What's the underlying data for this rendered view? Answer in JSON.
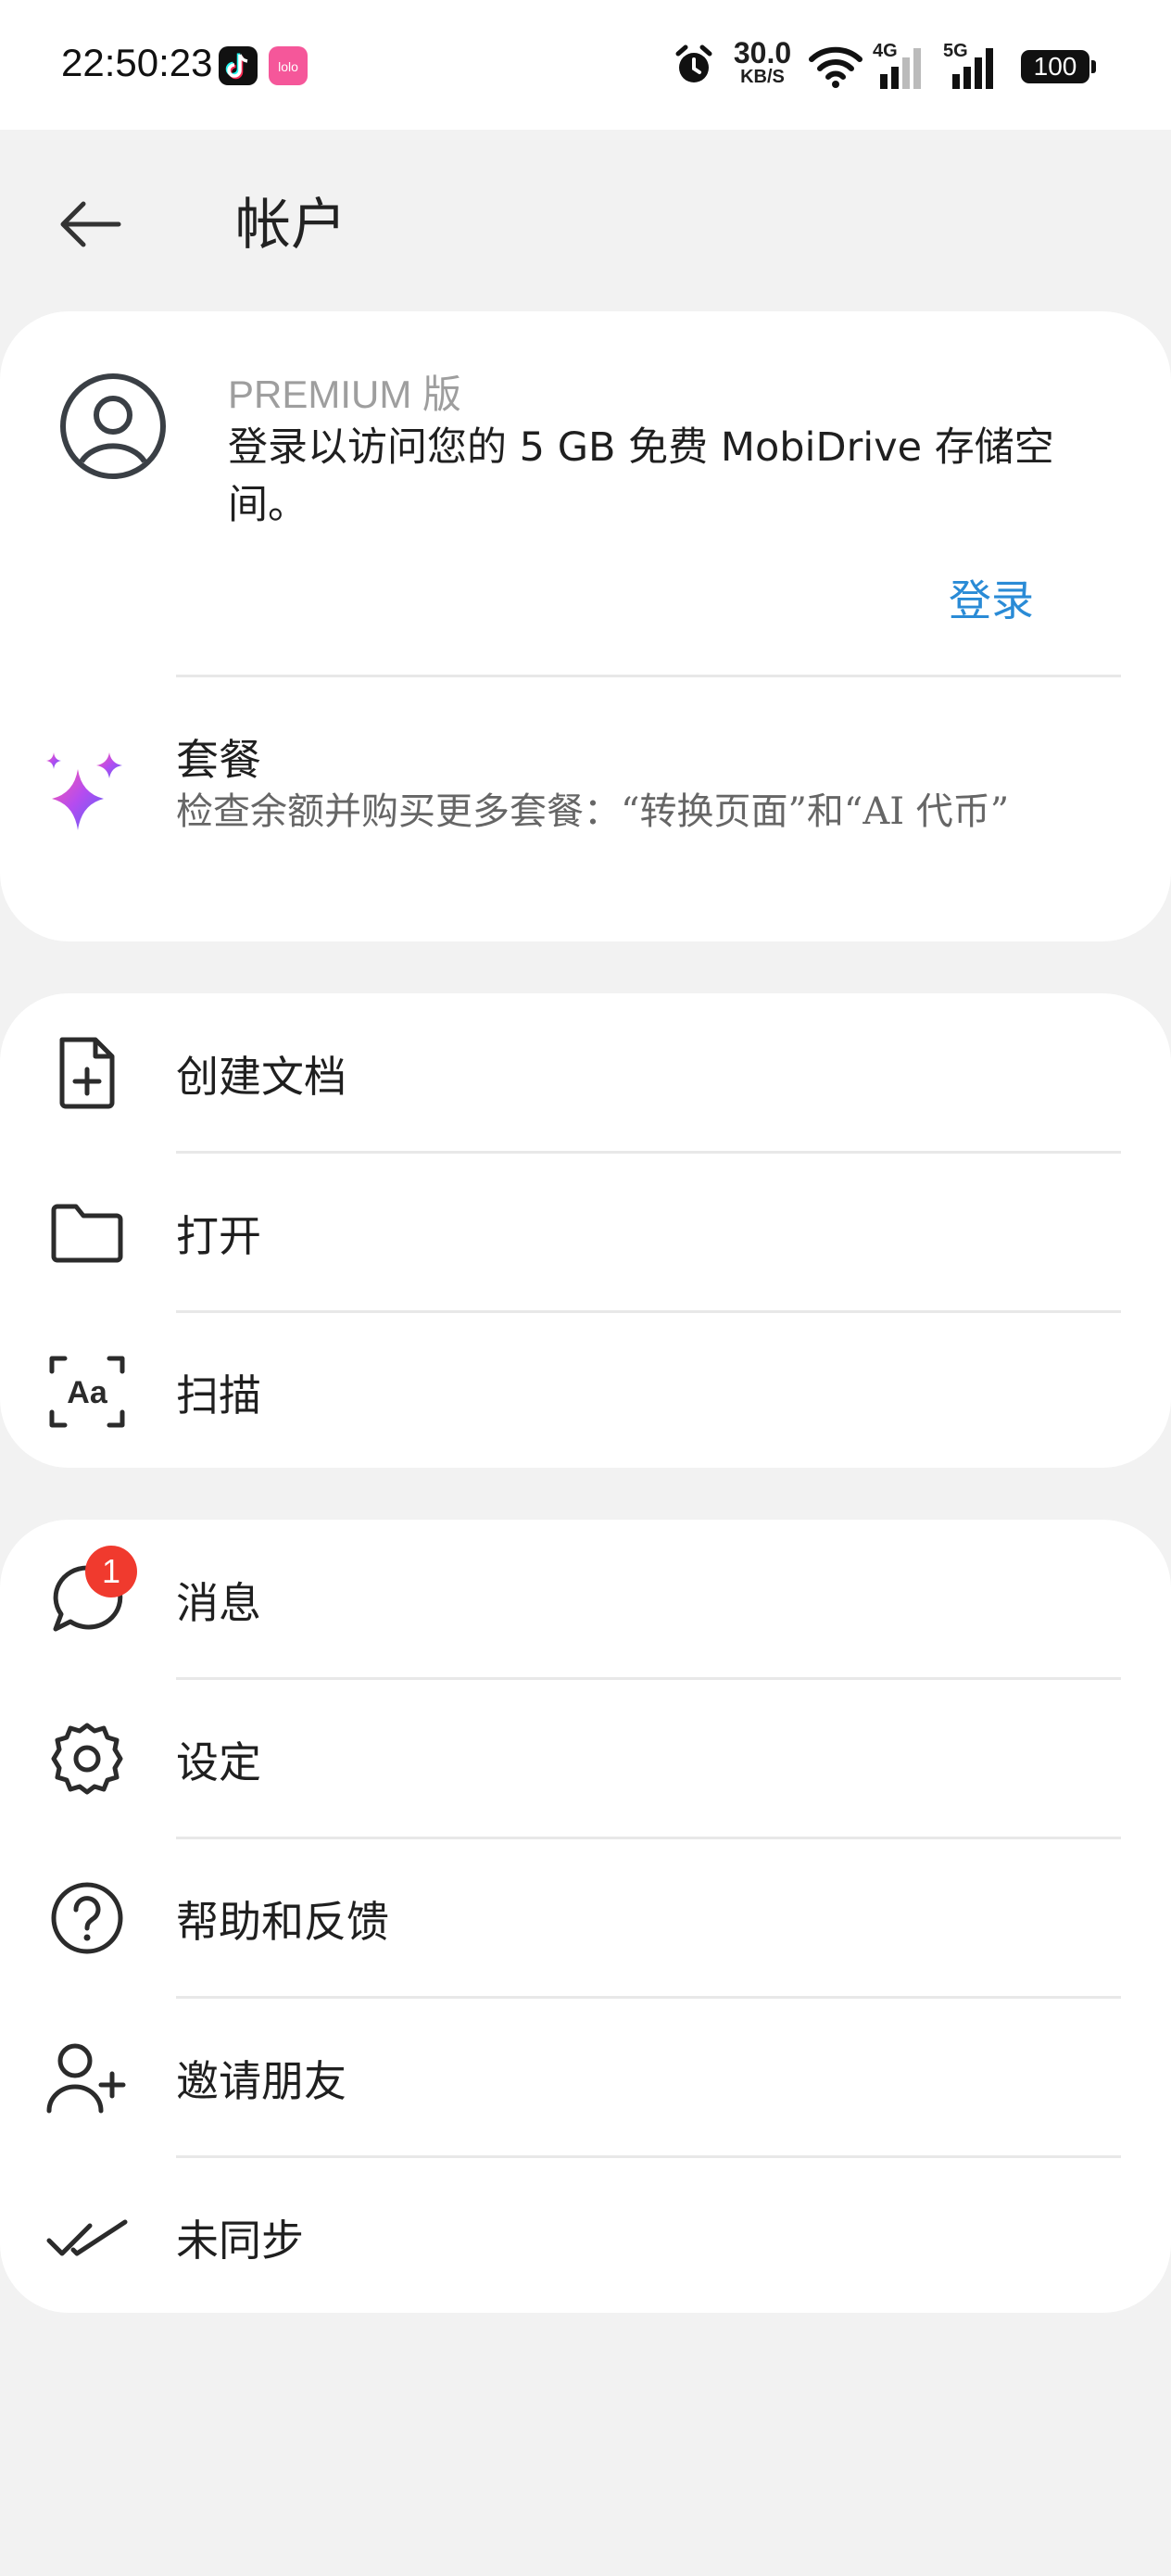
{
  "status_bar": {
    "time": "22:50:23",
    "net_speed_value": "30.0",
    "net_speed_unit": "KB/S",
    "net_4g": "4G",
    "net_5g": "5G",
    "battery": "100"
  },
  "header": {
    "title": "帐户"
  },
  "account": {
    "edition": "PREMIUM 版",
    "description": "登录以访问您的 5 GB 免费 MobiDrive 存储空间。",
    "login_label": "登录"
  },
  "plan": {
    "title": "套餐",
    "description": "检查余额并购买更多套餐：“转换页面”和“AI 代币”"
  },
  "file_menu": [
    {
      "label": "创建文档",
      "icon": "new-document-icon"
    },
    {
      "label": "打开",
      "icon": "folder-icon"
    },
    {
      "label": "扫描",
      "icon": "scan-text-icon"
    }
  ],
  "other_menu": [
    {
      "label": "消息",
      "icon": "message-icon",
      "badge": "1"
    },
    {
      "label": "设定",
      "icon": "gear-icon"
    },
    {
      "label": "帮助和反馈",
      "icon": "help-icon"
    },
    {
      "label": "邀请朋友",
      "icon": "add-user-icon"
    },
    {
      "label": "未同步",
      "icon": "double-check-icon"
    }
  ],
  "colors": {
    "accent": "#2a8bd6",
    "badge": "#f03a2e",
    "background": "#f2f2f2",
    "card": "#ffffff"
  }
}
